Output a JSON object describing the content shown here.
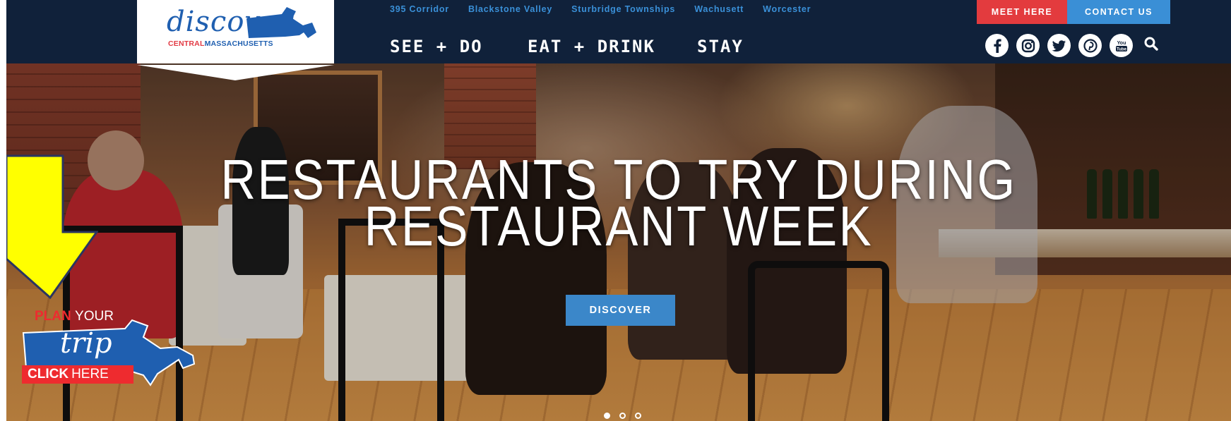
{
  "brand": {
    "logo_script": "discover",
    "logo_sub_a": "CENTRAL",
    "logo_sub_b": "MASSACHUSETTS",
    "logo_heart": "♥"
  },
  "regions": [
    "395 Corridor",
    "Blackstone Valley",
    "Sturbridge Townships",
    "Wachusett",
    "Worcester"
  ],
  "nav": [
    "SEE + DO",
    "EAT + DRINK",
    "STAY"
  ],
  "utility": {
    "meet_label": "MEET HERE",
    "contact_label": "CONTACT US"
  },
  "social": [
    {
      "name": "facebook-icon",
      "glyph": "f"
    },
    {
      "name": "instagram-icon",
      "glyph": ""
    },
    {
      "name": "twitter-icon",
      "glyph": ""
    },
    {
      "name": "pinterest-icon",
      "glyph": "p"
    },
    {
      "name": "youtube-icon",
      "glyph": "You"
    }
  ],
  "hero": {
    "title_line1": "RESTAURANTS TO TRY DURING",
    "title_line2": "RESTAURANT WEEK",
    "cta_label": "DISCOVER",
    "slides": 3,
    "active_slide": 1
  },
  "plan_badge": {
    "plan": "PLAN",
    "your": "YOUR",
    "trip": "trip",
    "click": "CLICK",
    "here": "HERE"
  },
  "colors": {
    "header_bg": "#10213a",
    "region_link": "#3a90d8",
    "meet_bg": "#e33b3e",
    "contact_bg": "#3a8fd6",
    "cta_bg": "#3b87c9",
    "plan_red": "#ee2b2f",
    "map_blue": "#1f5fb0",
    "arrow_yellow": "#ffff00"
  }
}
